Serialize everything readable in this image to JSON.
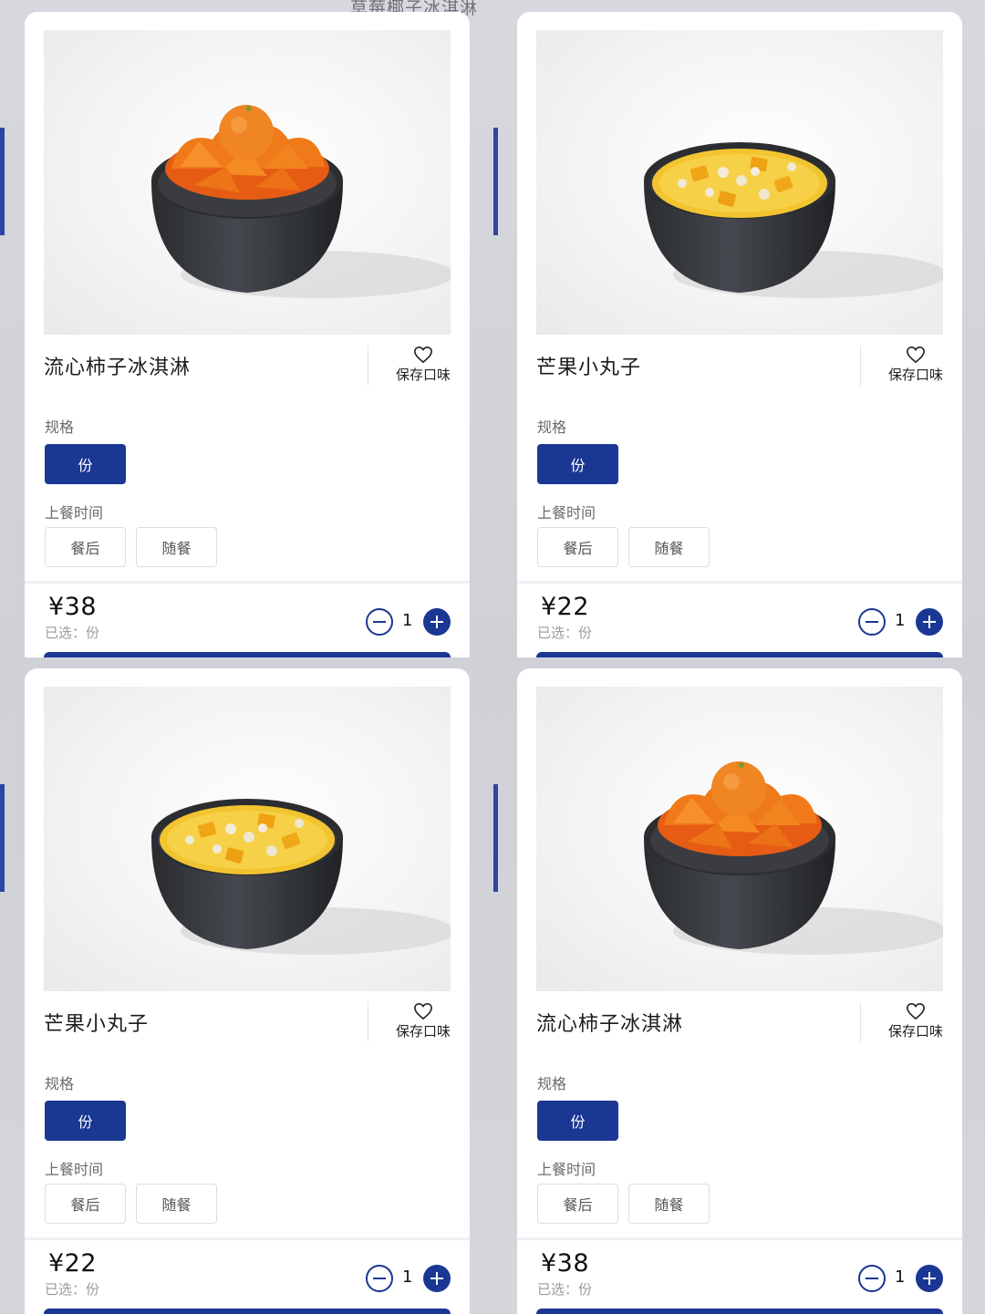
{
  "background": {
    "top_text": "草莓椰子冰淇淋"
  },
  "labels": {
    "spec": "规格",
    "serve_time": "上餐时间",
    "favorite": "保存口味"
  },
  "colors": {
    "accent": "#1a3793",
    "price_text": "#111111",
    "muted": "#9a9a9a"
  },
  "cards": [
    {
      "name": "流心柿子冰淇淋",
      "dish": "persimmon",
      "spec_option": "份",
      "serve_options": [
        "餐后",
        "随餐"
      ],
      "price": "¥38",
      "selected_text": "已选：份",
      "quantity": "1"
    },
    {
      "name": "芒果小丸子",
      "dish": "mango",
      "spec_option": "份",
      "serve_options": [
        "餐后",
        "随餐"
      ],
      "price": "¥22",
      "selected_text": "已选：份",
      "quantity": "1"
    },
    {
      "name": "芒果小丸子",
      "dish": "mango",
      "spec_option": "份",
      "serve_options": [
        "餐后",
        "随餐"
      ],
      "price": "¥22",
      "selected_text": "已选：份",
      "quantity": "1"
    },
    {
      "name": "流心柿子冰淇淋",
      "dish": "persimmon",
      "spec_option": "份",
      "serve_options": [
        "餐后",
        "随餐"
      ],
      "price": "¥38",
      "selected_text": "已选：份",
      "quantity": "1"
    }
  ]
}
